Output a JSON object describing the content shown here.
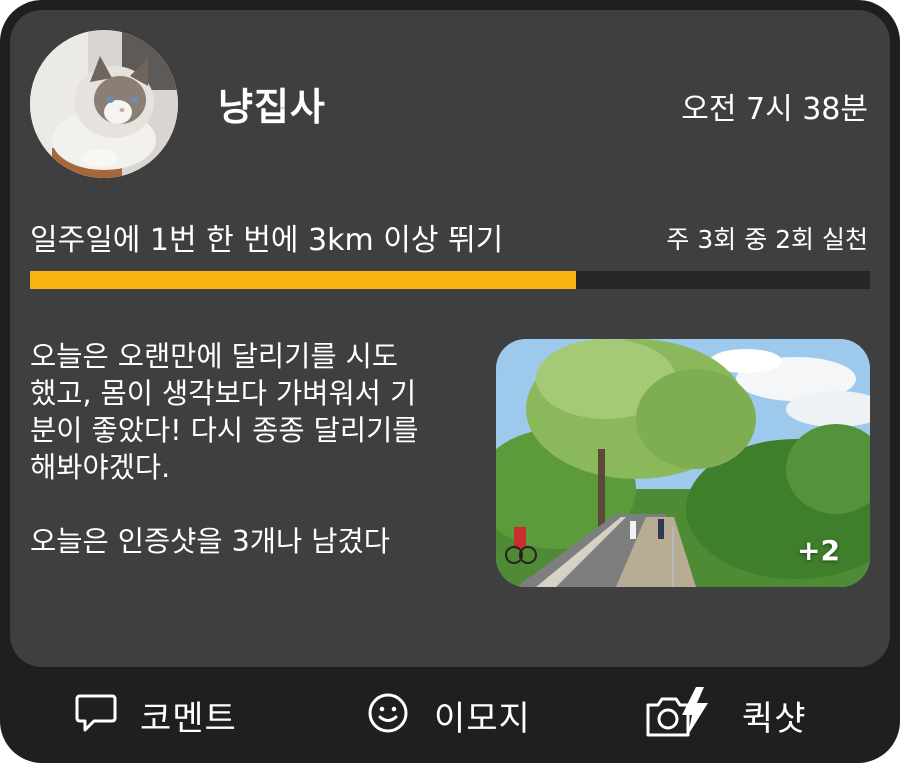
{
  "post": {
    "username": "냥집사",
    "timestamp": "오전 7시 38분",
    "avatar_icon": "cat-photo",
    "goal": {
      "title": "일주일에 1번 한 번에 3km 이상 뛰기",
      "status": "주 3회 중 2회 실천",
      "progress": 0.65,
      "progress_color": "#f7b412"
    },
    "body": "오늘은 오랜만에 달리기를 시도\n했고, 몸이 생각보다 가벼워서 기\n분이 좋았다! 다시 종종 달리기를\n해봐야겠다.\n\n오늘은 인증샷을 3개나 남겼다",
    "photo": {
      "icon": "park-running-path-photo",
      "more_count": "+2"
    }
  },
  "actions": {
    "comment": {
      "label": "코멘트",
      "icon": "speech-bubble-icon"
    },
    "emoji": {
      "label": "이모지",
      "icon": "smiley-icon"
    },
    "quickshot": {
      "label": "퀵샷",
      "icon": "camera-flash-icon"
    }
  },
  "colors": {
    "background": "#1f1f1f",
    "card": "#3f3f3f",
    "track": "#262626",
    "accent": "#f7b412",
    "text": "#ffffff"
  }
}
